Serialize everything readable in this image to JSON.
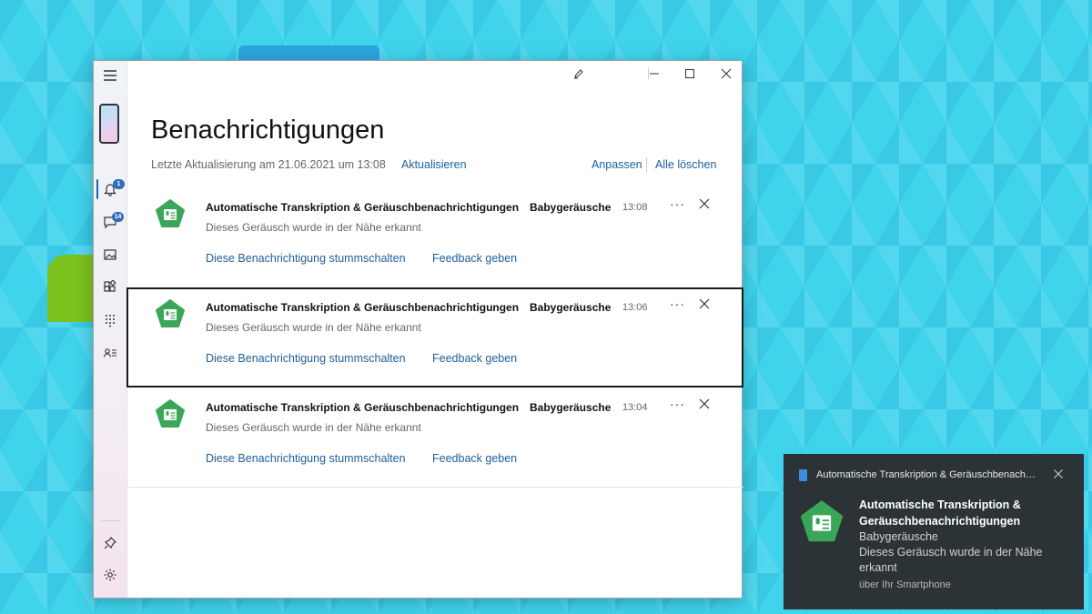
{
  "window": {
    "heading": "Benachrichtigungen",
    "last_update": "Letzte Aktualisierung am 21.06.2021 um 13:08",
    "refresh_label": "Aktualisieren",
    "customize_label": "Anpassen",
    "clear_all_label": "Alle löschen"
  },
  "sidebar": {
    "notifications_badge": "1",
    "messages_badge": "14",
    "items": [
      {
        "icon": "menu-icon"
      },
      {
        "icon": "phone-screen-icon"
      },
      {
        "icon": "bell-icon"
      },
      {
        "icon": "chat-icon"
      },
      {
        "icon": "photos-icon"
      },
      {
        "icon": "apps-icon"
      },
      {
        "icon": "dialpad-icon"
      },
      {
        "icon": "contacts-icon"
      },
      {
        "icon": "pin-icon"
      },
      {
        "icon": "gear-icon"
      }
    ]
  },
  "notifications": [
    {
      "app": "Automatische Transkription & Geräuschbenachrichtigungen",
      "subtitle": "Babygeräusche",
      "time": "13:08",
      "body": "Dieses Geräusch wurde in der Nähe erkannt",
      "mute_label": "Diese Benachrichtigung stummschalten",
      "feedback_label": "Feedback geben",
      "more_label": "···"
    },
    {
      "app": "Automatische Transkription & Geräuschbenachrichtigungen",
      "subtitle": "Babygeräusche",
      "time": "13:06",
      "body": "Dieses Geräusch wurde in der Nähe erkannt",
      "mute_label": "Diese Benachrichtigung stummschalten",
      "feedback_label": "Feedback geben",
      "more_label": "···"
    },
    {
      "app": "Automatische Transkription & Geräuschbenachrichtigungen",
      "subtitle": "Babygeräusche",
      "time": "13:04",
      "body": "Dieses Geräusch wurde in der Nähe erkannt",
      "mute_label": "Diese Benachrichtigung stummschalten",
      "feedback_label": "Feedback geben",
      "more_label": "···"
    }
  ],
  "toast": {
    "app_header": "Automatische Transkription & Geräuschbenach…",
    "title": "Automatische Transkription & Geräuschbenachrichtigungen",
    "subtitle": "Babygeräusche",
    "body": "Dieses Geräusch wurde in der Nähe erkannt",
    "footer": "über Ihr Smartphone"
  },
  "colors": {
    "accent": "#1d5f9c",
    "app_icon_green": "#3aa657",
    "toast_bg": "#2b3336",
    "desktop_bg": "#3fd3ec"
  }
}
